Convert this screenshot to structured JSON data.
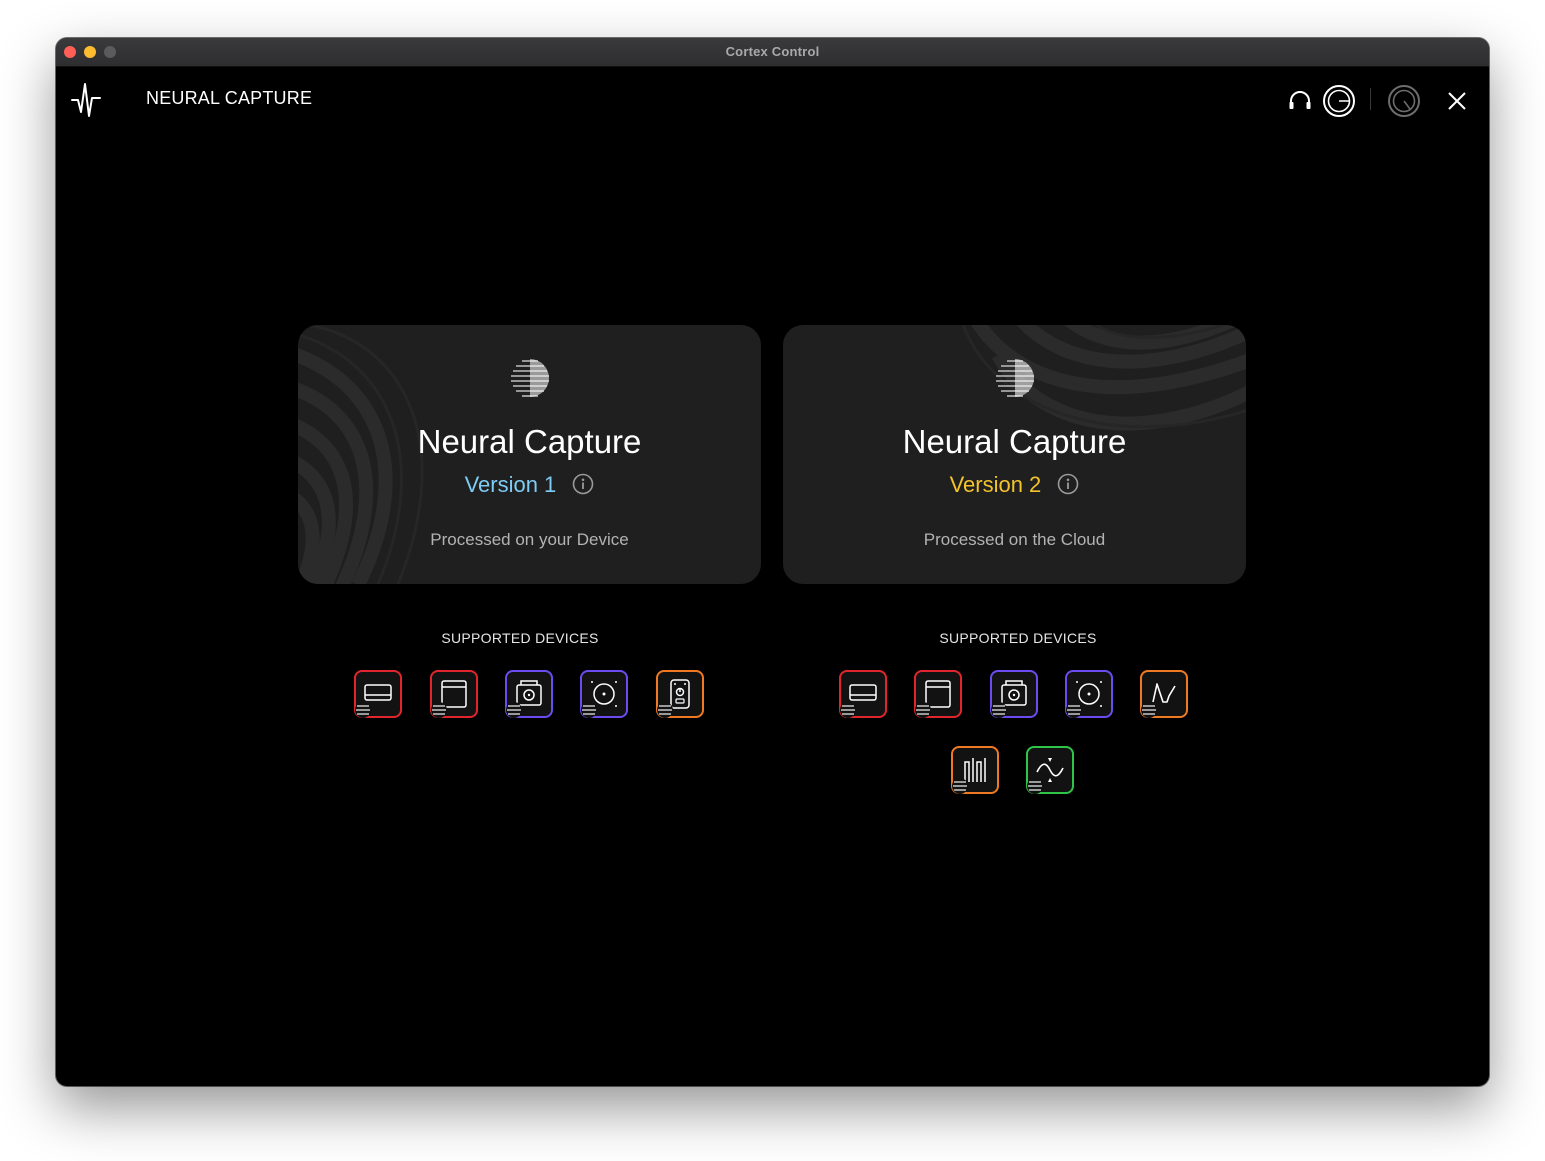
{
  "window": {
    "title": "Cortex Control"
  },
  "header": {
    "title": "NEURAL CAPTURE",
    "logo_icon": "waveform-pulse-icon",
    "actions": [
      {
        "icon": "headphones-icon"
      },
      {
        "icon": "knob-icon"
      },
      {
        "icon": "knob-dim-icon"
      },
      {
        "icon": "close-icon"
      }
    ]
  },
  "cards": [
    {
      "title": "Neural Capture",
      "version": "Version 1",
      "version_color": "#7ecbf4",
      "subtitle": "Processed on your Device",
      "icon": "striped-sphere-icon"
    },
    {
      "title": "Neural Capture",
      "version": "Version 2",
      "version_color": "#f3c32a",
      "subtitle": "Processed on the Cloud",
      "icon": "striped-sphere-icon"
    }
  ],
  "supported": {
    "v1": {
      "label": "SUPPORTED DEVICES",
      "devices": [
        {
          "icon": "amp-head-icon",
          "color": "#e0262c"
        },
        {
          "icon": "amp-combo-icon",
          "color": "#e0262c"
        },
        {
          "icon": "cab-speaker-icon",
          "color": "#6c4cf0"
        },
        {
          "icon": "speaker-cone-icon",
          "color": "#6c4cf0"
        },
        {
          "icon": "pedal-icon",
          "color": "#ef7a22"
        }
      ]
    },
    "v2": {
      "label": "SUPPORTED DEVICES",
      "devices": [
        {
          "icon": "amp-head-icon",
          "color": "#e0262c"
        },
        {
          "icon": "amp-combo-icon",
          "color": "#e0262c"
        },
        {
          "icon": "cab-speaker-icon",
          "color": "#6c4cf0"
        },
        {
          "icon": "speaker-cone-icon",
          "color": "#6c4cf0"
        },
        {
          "icon": "waveform-curve-icon",
          "color": "#ef7a22"
        },
        {
          "icon": "rack-bars-icon",
          "color": "#ef7a22"
        },
        {
          "icon": "modulation-icon",
          "color": "#2fc548"
        }
      ]
    }
  }
}
